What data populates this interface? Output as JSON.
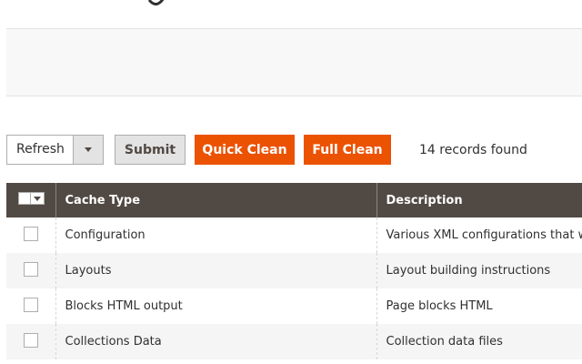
{
  "toolbar": {
    "action_select_value": "Refresh",
    "submit_label": "Submit",
    "quick_clean_label": "Quick Clean",
    "full_clean_label": "Full Clean",
    "records_found": "14 records found"
  },
  "grid": {
    "columns": {
      "cache_type": "Cache Type",
      "description": "Description"
    },
    "rows": [
      {
        "cache_type": "Configuration",
        "description": "Various XML configurations that were"
      },
      {
        "cache_type": "Layouts",
        "description": "Layout building instructions"
      },
      {
        "cache_type": "Blocks HTML output",
        "description": "Page blocks HTML"
      },
      {
        "cache_type": "Collections Data",
        "description": "Collection data files"
      }
    ]
  },
  "colors": {
    "accent_orange": "#eb5202",
    "header_brown": "#514943",
    "button_grey": "#e3e3e3",
    "panel_bg": "#f8f8f8"
  },
  "icons": {
    "select_arrow": "chevron-down-icon",
    "mass_action_arrow": "caret-down-icon"
  }
}
